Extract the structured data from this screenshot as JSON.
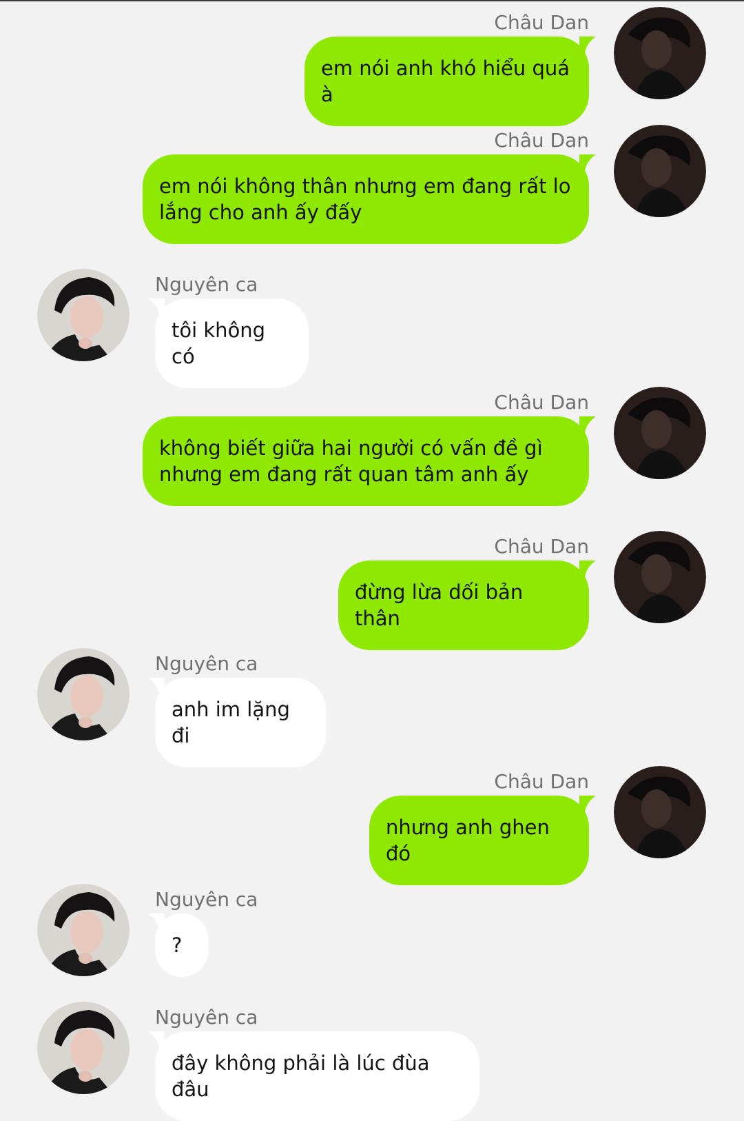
{
  "colors": {
    "background": "#f2f2f2",
    "outgoing_bubble": "#8fe800",
    "incoming_bubble": "#ffffff",
    "name_text": "#6f6f6f",
    "message_text": "#141414"
  },
  "participants": {
    "me": {
      "name": "Châu Dan",
      "avatar_icon": "dark-portrait-avatar"
    },
    "other": {
      "name": "Nguyên ca",
      "avatar_icon": "portrait-avatar-hand-on-chin"
    }
  },
  "messages": [
    {
      "sender": "Châu Dan",
      "direction": "outgoing",
      "text": "em nói anh khó hiểu quá à"
    },
    {
      "sender": "Châu Dan",
      "direction": "outgoing",
      "text": "em nói không thân nhưng em đang rất lo lắng cho anh ấy đấy"
    },
    {
      "sender": "Nguyên ca",
      "direction": "incoming",
      "text": "tôi không có"
    },
    {
      "sender": "Châu Dan",
      "direction": "outgoing",
      "text": "không biết giữa hai người có vấn đề gì nhưng em đang rất quan tâm anh ấy"
    },
    {
      "sender": "Châu Dan",
      "direction": "outgoing",
      "text": "đừng lừa dối bản thân"
    },
    {
      "sender": "Nguyên ca",
      "direction": "incoming",
      "text": "anh im lặng đi"
    },
    {
      "sender": "Châu Dan",
      "direction": "outgoing",
      "text": "nhưng anh ghen đó"
    },
    {
      "sender": "Nguyên ca",
      "direction": "incoming",
      "text": "?"
    },
    {
      "sender": "Nguyên ca",
      "direction": "incoming",
      "text": "đây không phải là lúc đùa đâu"
    }
  ]
}
